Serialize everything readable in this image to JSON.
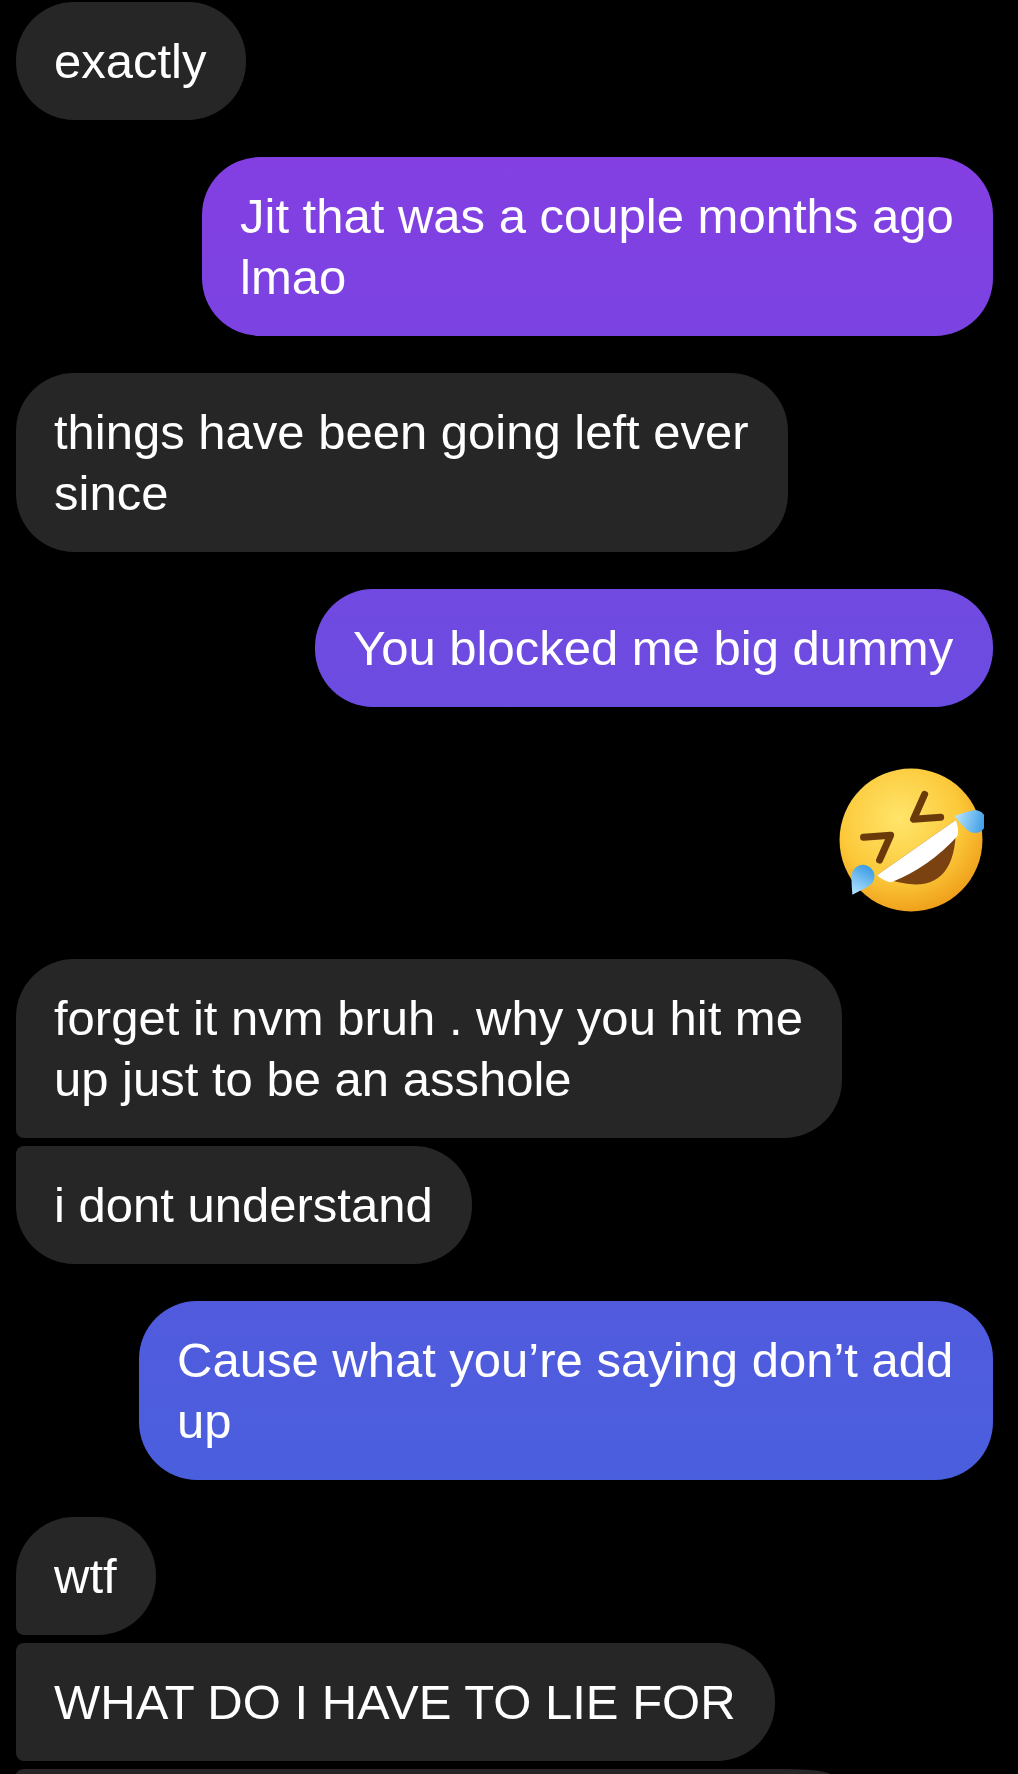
{
  "messages": [
    {
      "kind": "text",
      "outgoing": false,
      "joined_above": false,
      "joined_below": false,
      "text": "exactly"
    },
    {
      "kind": "text",
      "outgoing": true,
      "joined_above": false,
      "joined_below": false,
      "text": "Jit that was a couple months ago lmao"
    },
    {
      "kind": "text",
      "outgoing": false,
      "joined_above": false,
      "joined_below": false,
      "text": "things have been going left ever since"
    },
    {
      "kind": "text",
      "outgoing": true,
      "joined_above": false,
      "joined_below": false,
      "text": "You blocked me big dummy"
    },
    {
      "kind": "emoji",
      "outgoing": true
    },
    {
      "kind": "text",
      "outgoing": false,
      "joined_above": false,
      "joined_below": true,
      "text": "forget it nvm bruh . why you hit me up just to be an asshole"
    },
    {
      "kind": "text",
      "outgoing": false,
      "joined_above": true,
      "joined_below": false,
      "text": "i dont understand"
    },
    {
      "kind": "text",
      "outgoing": true,
      "joined_above": false,
      "joined_below": false,
      "text": "Cause what you’re saying don’t add up"
    },
    {
      "kind": "text",
      "outgoing": false,
      "joined_above": false,
      "joined_below": true,
      "text": "wtf"
    },
    {
      "kind": "text",
      "outgoing": false,
      "joined_above": true,
      "joined_below": true,
      "text": "WHAT DO I HAVE TO LIE FOR"
    },
    {
      "kind": "partial",
      "outgoing": false,
      "joined_above": true
    }
  ]
}
